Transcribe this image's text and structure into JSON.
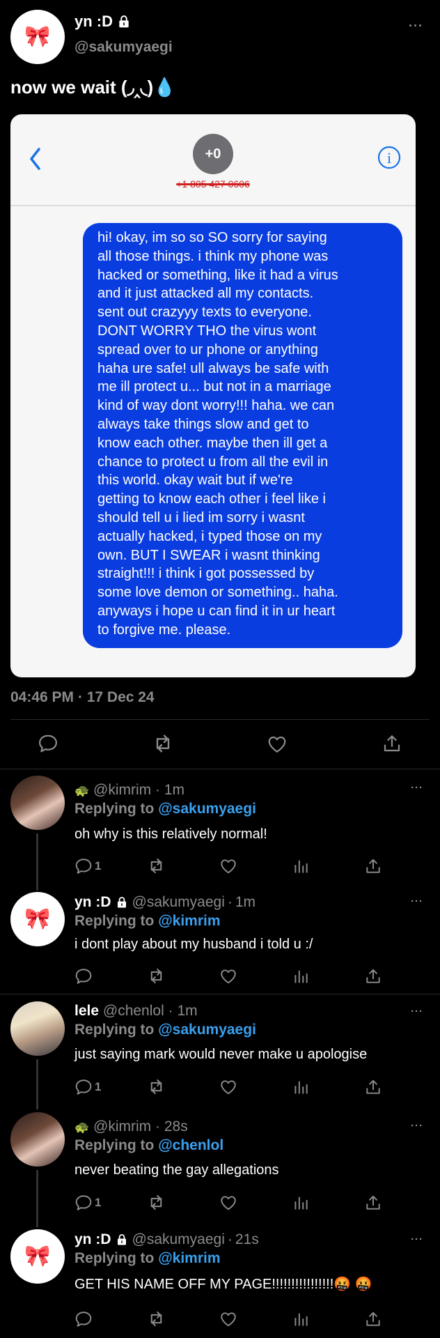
{
  "tweet": {
    "display_name": "yn :D",
    "handle": "@sakumyaegi",
    "avatar_emoji": "🎀",
    "text": "now we wait (◞‸◟)💧",
    "timestamp": "04:46 PM · 17 Dec 24",
    "more": "···"
  },
  "screenshot": {
    "contact_initials": "+0",
    "contact_number": "+1 805 427 0606",
    "message": "hi! okay, im so so SO sorry for saying\nall those things. i think my phone was\nhacked or something, like it had a virus\nand it just attacked all my contacts.\nsent out crazyyy texts to everyone.\nDONT WORRY THO the virus wont\nspread over to ur phone or anything\nhaha ure safe! ull always be safe with\nme ill protect u... but not in a marriage\nkind of way dont worry!!! haha. we can\nalways take things slow and get to\nknow each other. maybe then ill get a\nchance to protect u from all the evil in\nthis world. okay wait but if we're\ngetting to know each other i feel like i\nshould tell u i lied im sorry i wasnt\nactually hacked, i typed those on my\nown. BUT I SWEAR i wasnt thinking\nstraight!!! i think i got possessed by\nsome love demon or something.. haha.\nanyways i hope u can find it in ur heart\nto forgive me. please."
  },
  "replies": [
    {
      "name": "",
      "name_emoji": "🐢",
      "handle": "@kimrim",
      "time": "1m",
      "replying_label": "Replying to",
      "replying_to": "@sakumyaegi",
      "text": "oh why is this relatively normal!",
      "reply_count": "1"
    },
    {
      "name": "yn :D",
      "handle": "@sakumyaegi",
      "time": "1m",
      "replying_label": "Replying to",
      "replying_to": "@kimrim",
      "text": "i dont play about my husband i told u :/",
      "reply_count": ""
    },
    {
      "name": "lele",
      "handle": "@chenlol",
      "time": "1m",
      "replying_label": "Replying to",
      "replying_to": "@sakumyaegi",
      "text": "just saying mark would never make u apologise",
      "reply_count": "1"
    },
    {
      "name": "",
      "name_emoji": "🐢",
      "handle": "@kimrim",
      "time": "28s",
      "replying_label": "Replying to",
      "replying_to": "@chenlol",
      "text": "never beating the gay allegations",
      "reply_count": "1"
    },
    {
      "name": "yn :D",
      "handle": "@sakumyaegi",
      "time": "21s",
      "replying_label": "Replying to",
      "replying_to": "@kimrim",
      "text": "GET HIS NAME OFF MY PAGE!!!!!!!!!!!!!!!!🤬 🤬",
      "reply_count": ""
    }
  ],
  "dot": "·",
  "colors": {
    "accent": "#3aa0ef",
    "bubble": "#0a3de0",
    "background": "#000000",
    "muted": "#8b8b8b"
  },
  "icons": [
    "lock-icon",
    "reply-icon",
    "retweet-icon",
    "like-icon",
    "analytics-icon",
    "share-icon",
    "back-chevron-icon",
    "info-icon"
  ]
}
